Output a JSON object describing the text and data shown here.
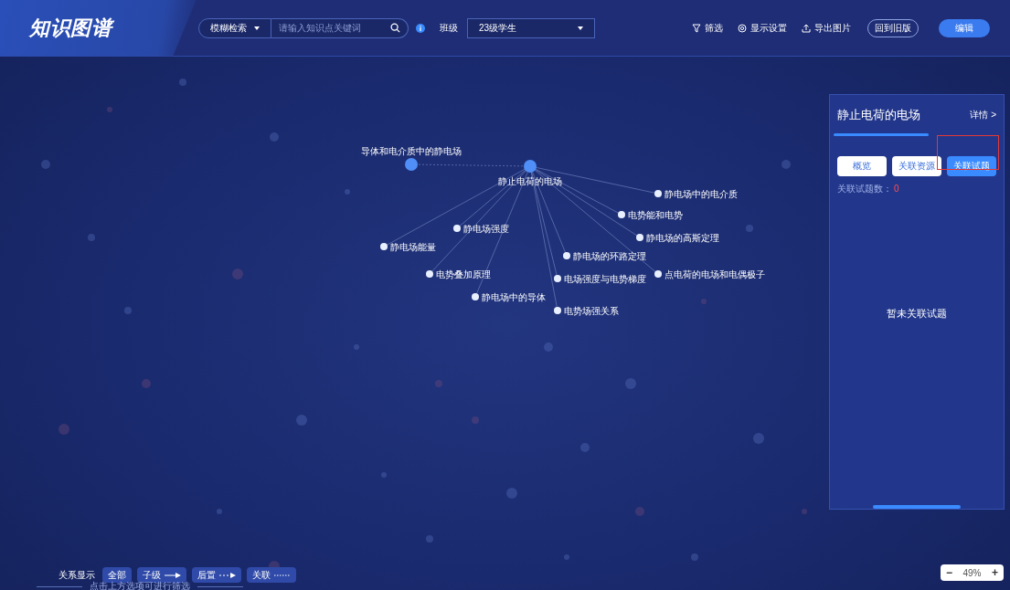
{
  "header": {
    "logo": "知识图谱",
    "search_mode": "模糊检索",
    "search": {
      "placeholder": "请输入知识点关键词"
    },
    "class_label": "班级",
    "class_value": "23级学生",
    "actions": [
      {
        "label": "筛选",
        "kind": "filter"
      },
      {
        "label": "显示设置",
        "kind": "settings"
      },
      {
        "label": "导出图片",
        "kind": "export"
      }
    ],
    "buttons": [
      {
        "label": "回到旧版",
        "kind": "outline"
      },
      {
        "label": "编辑",
        "kind": "primary"
      }
    ]
  },
  "graph": {
    "nodes": [
      {
        "label": "导体和电介质中的静电场",
        "kind": "major"
      },
      {
        "label": "静止电荷的电场",
        "kind": "center"
      },
      {
        "label": "静电场中的电介质",
        "kind": "minor"
      },
      {
        "label": "电势能和电势",
        "kind": "minor"
      },
      {
        "label": "静电场的高斯定理",
        "kind": "minor"
      },
      {
        "label": "静电场的环路定理",
        "kind": "minor"
      },
      {
        "label": "静电场强度",
        "kind": "minor"
      },
      {
        "label": "静电场能量",
        "kind": "minor"
      },
      {
        "label": "电场强度与电势梯度",
        "kind": "minor"
      },
      {
        "label": "电势叠加原理",
        "kind": "minor"
      },
      {
        "label": "静电场中的导体",
        "kind": "minor"
      },
      {
        "label": "点电荷的电场和电偶极子",
        "kind": "minor"
      },
      {
        "label": "电势场强关系",
        "kind": "minor"
      }
    ]
  },
  "panel": {
    "title": "静止电荷的电场",
    "detail": "详情 >",
    "tabs": [
      {
        "label": "概览",
        "selected": false
      },
      {
        "label": "关联资源",
        "selected": false
      },
      {
        "label": "关联试题",
        "selected": true
      }
    ],
    "count_label": "关联试题数：",
    "count": "0",
    "empty": "暂未关联试题"
  },
  "legend": {
    "label": "关系显示",
    "items": [
      {
        "label": "全部",
        "kind": "all"
      },
      {
        "label": "子级",
        "kind": "child"
      },
      {
        "label": "后置",
        "kind": "next"
      },
      {
        "label": "关联",
        "kind": "related"
      }
    ],
    "hint": "点击上方选项可进行筛选"
  },
  "zoom": {
    "minus": "−",
    "value": "49%",
    "plus": "+"
  }
}
